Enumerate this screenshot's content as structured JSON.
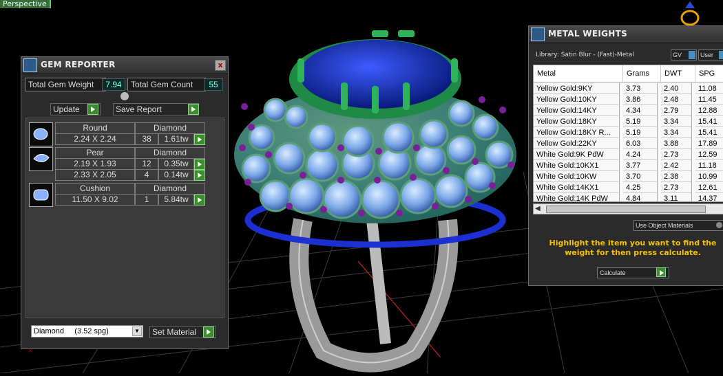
{
  "viewport": {
    "label": "Perspective"
  },
  "gem_reporter": {
    "title": "GEM REPORTER",
    "total_weight_label": "Total Gem Weight",
    "total_weight_value": "7.94",
    "total_count_label": "Total Gem Count",
    "total_count_value": "55",
    "update_label": "Update",
    "save_report_label": "Save Report",
    "groups": [
      {
        "shape": "Round",
        "material": "Diamond",
        "rows": [
          {
            "size": "2.24 X 2.24",
            "count": "38",
            "tw": "1.61tw"
          }
        ]
      },
      {
        "shape": "Pear",
        "material": "Diamond",
        "rows": [
          {
            "size": "2.19 X 1.93",
            "count": "12",
            "tw": "0.35tw"
          },
          {
            "size": "2.33 X 2.05",
            "count": "4",
            "tw": "0.14tw"
          }
        ]
      },
      {
        "shape": "Cushion",
        "material": "Diamond",
        "rows": [
          {
            "size": "11.50 X 9.02",
            "count": "1",
            "tw": "5.84tw"
          }
        ]
      }
    ],
    "material_select": "Diamond     (3.52 spg)",
    "set_material_label": "Set Material"
  },
  "metal_weights": {
    "title": "METAL WEIGHTS",
    "library": "Library: Satin Blur - (Fast)-Metal",
    "gv_label": "GV",
    "user_label": "User",
    "columns": [
      "Metal",
      "Grams",
      "DWT",
      "SPG"
    ],
    "rows": [
      [
        "Yellow Gold:9KY",
        "3.73",
        "2.40",
        "11.08"
      ],
      [
        "Yellow Gold:10KY",
        "3.86",
        "2.48",
        "11.45"
      ],
      [
        "Yellow Gold:14KY",
        "4.34",
        "2.79",
        "12.88"
      ],
      [
        "Yellow Gold:18KY",
        "5.19",
        "3.34",
        "15.41"
      ],
      [
        "Yellow Gold:18KY R...",
        "5.19",
        "3.34",
        "15.41"
      ],
      [
        "Yellow Gold:22KY",
        "6.03",
        "3.88",
        "17.89"
      ],
      [
        "White Gold:9K PdW",
        "4.24",
        "2.73",
        "12.59"
      ],
      [
        "White Gold:10KX1",
        "3.77",
        "2.42",
        "11.18"
      ],
      [
        "White Gold:10KW",
        "3.70",
        "2.38",
        "10.99"
      ],
      [
        "White Gold:14KX1",
        "4.25",
        "2.73",
        "12.61"
      ],
      [
        "White Gold:14K PdW",
        "4.84",
        "3.11",
        "14.37"
      ]
    ],
    "use_object_materials": "Use Object Materials",
    "hint": "Highlight the item you want to find the weight for then press calculate.",
    "calculate_label": "Calculate",
    "hint_color": "#f2c200"
  }
}
